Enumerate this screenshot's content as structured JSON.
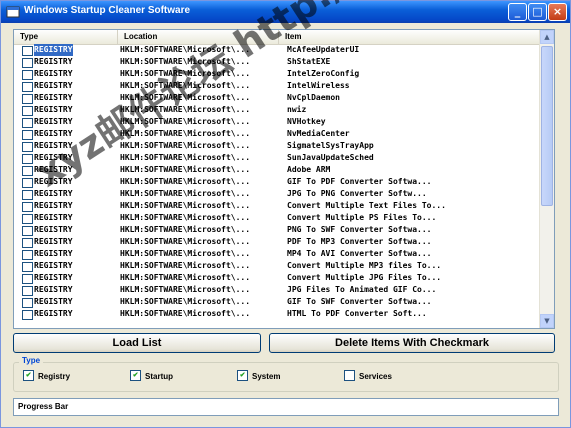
{
  "window": {
    "title": "Windows Startup Cleaner Software"
  },
  "columns": {
    "type": "Type",
    "location": "Location",
    "item": "Item"
  },
  "rows": [
    {
      "type": "REGISTRY",
      "location": "HKLM:SOFTWARE\\Microsoft\\...",
      "item": "McAfeeUpdaterUI"
    },
    {
      "type": "REGISTRY",
      "location": "HKLM:SOFTWARE\\Microsoft\\...",
      "item": "ShStatEXE"
    },
    {
      "type": "REGISTRY",
      "location": "HKLM:SOFTWARE\\Microsoft\\...",
      "item": "IntelZeroConfig"
    },
    {
      "type": "REGISTRY",
      "location": "HKLM:SOFTWARE\\Microsoft\\...",
      "item": "IntelWireless"
    },
    {
      "type": "REGISTRY",
      "location": "HKLM:SOFTWARE\\Microsoft\\...",
      "item": "NvCplDaemon"
    },
    {
      "type": "REGISTRY",
      "location": "HKLM:SOFTWARE\\Microsoft\\...",
      "item": "nwiz"
    },
    {
      "type": "REGISTRY",
      "location": "HKLM:SOFTWARE\\Microsoft\\...",
      "item": "NVHotkey"
    },
    {
      "type": "REGISTRY",
      "location": "HKLM:SOFTWARE\\Microsoft\\...",
      "item": "NvMediaCenter"
    },
    {
      "type": "REGISTRY",
      "location": "HKLM:SOFTWARE\\Microsoft\\...",
      "item": "SigmatelSysTrayApp"
    },
    {
      "type": "REGISTRY",
      "location": "HKLM:SOFTWARE\\Microsoft\\...",
      "item": "SunJavaUpdateSched"
    },
    {
      "type": "REGISTRY",
      "location": "HKLM:SOFTWARE\\Microsoft\\...",
      "item": "Adobe ARM"
    },
    {
      "type": "REGISTRY",
      "location": "HKLM:SOFTWARE\\Microsoft\\...",
      "item": "GIF To PDF Converter Softwa..."
    },
    {
      "type": "REGISTRY",
      "location": "HKLM:SOFTWARE\\Microsoft\\...",
      "item": "JPG To PNG Converter Softw..."
    },
    {
      "type": "REGISTRY",
      "location": "HKLM:SOFTWARE\\Microsoft\\...",
      "item": "Convert Multiple Text Files To..."
    },
    {
      "type": "REGISTRY",
      "location": "HKLM:SOFTWARE\\Microsoft\\...",
      "item": "Convert Multiple PS Files To..."
    },
    {
      "type": "REGISTRY",
      "location": "HKLM:SOFTWARE\\Microsoft\\...",
      "item": "PNG To SWF Converter Softwa..."
    },
    {
      "type": "REGISTRY",
      "location": "HKLM:SOFTWARE\\Microsoft\\...",
      "item": "PDF To MP3 Converter Softwa..."
    },
    {
      "type": "REGISTRY",
      "location": "HKLM:SOFTWARE\\Microsoft\\...",
      "item": "MP4 To AVI Converter Softwa..."
    },
    {
      "type": "REGISTRY",
      "location": "HKLM:SOFTWARE\\Microsoft\\...",
      "item": "Convert Multiple MP3 files To..."
    },
    {
      "type": "REGISTRY",
      "location": "HKLM:SOFTWARE\\Microsoft\\...",
      "item": "Convert Multiple JPG Files To..."
    },
    {
      "type": "REGISTRY",
      "location": "HKLM:SOFTWARE\\Microsoft\\...",
      "item": "JPG Files To Animated GIF Co..."
    },
    {
      "type": "REGISTRY",
      "location": "HKLM:SOFTWARE\\Microsoft\\...",
      "item": "GIF To SWF Converter Softwa..."
    },
    {
      "type": "REGISTRY",
      "location": "HKLM:SOFTWARE\\Microsoft\\...",
      "item": "HTML To PDF Converter Soft..."
    }
  ],
  "buttons": {
    "load": "Load List",
    "delete": "Delete Items With Checkmark"
  },
  "type_group": {
    "label": "Type",
    "options": [
      {
        "label": "Registry",
        "checked": true
      },
      {
        "label": "Startup",
        "checked": true
      },
      {
        "label": "System",
        "checked": true
      },
      {
        "label": "Services",
        "checked": false
      }
    ]
  },
  "progress": {
    "label": "Progress Bar"
  },
  "watermark": {
    "text": "xyz邮件论坛 http://31.to"
  },
  "colors": {
    "titlebar": "#0a5fd8",
    "selection": "#316ac5",
    "face": "#ece9d8"
  }
}
